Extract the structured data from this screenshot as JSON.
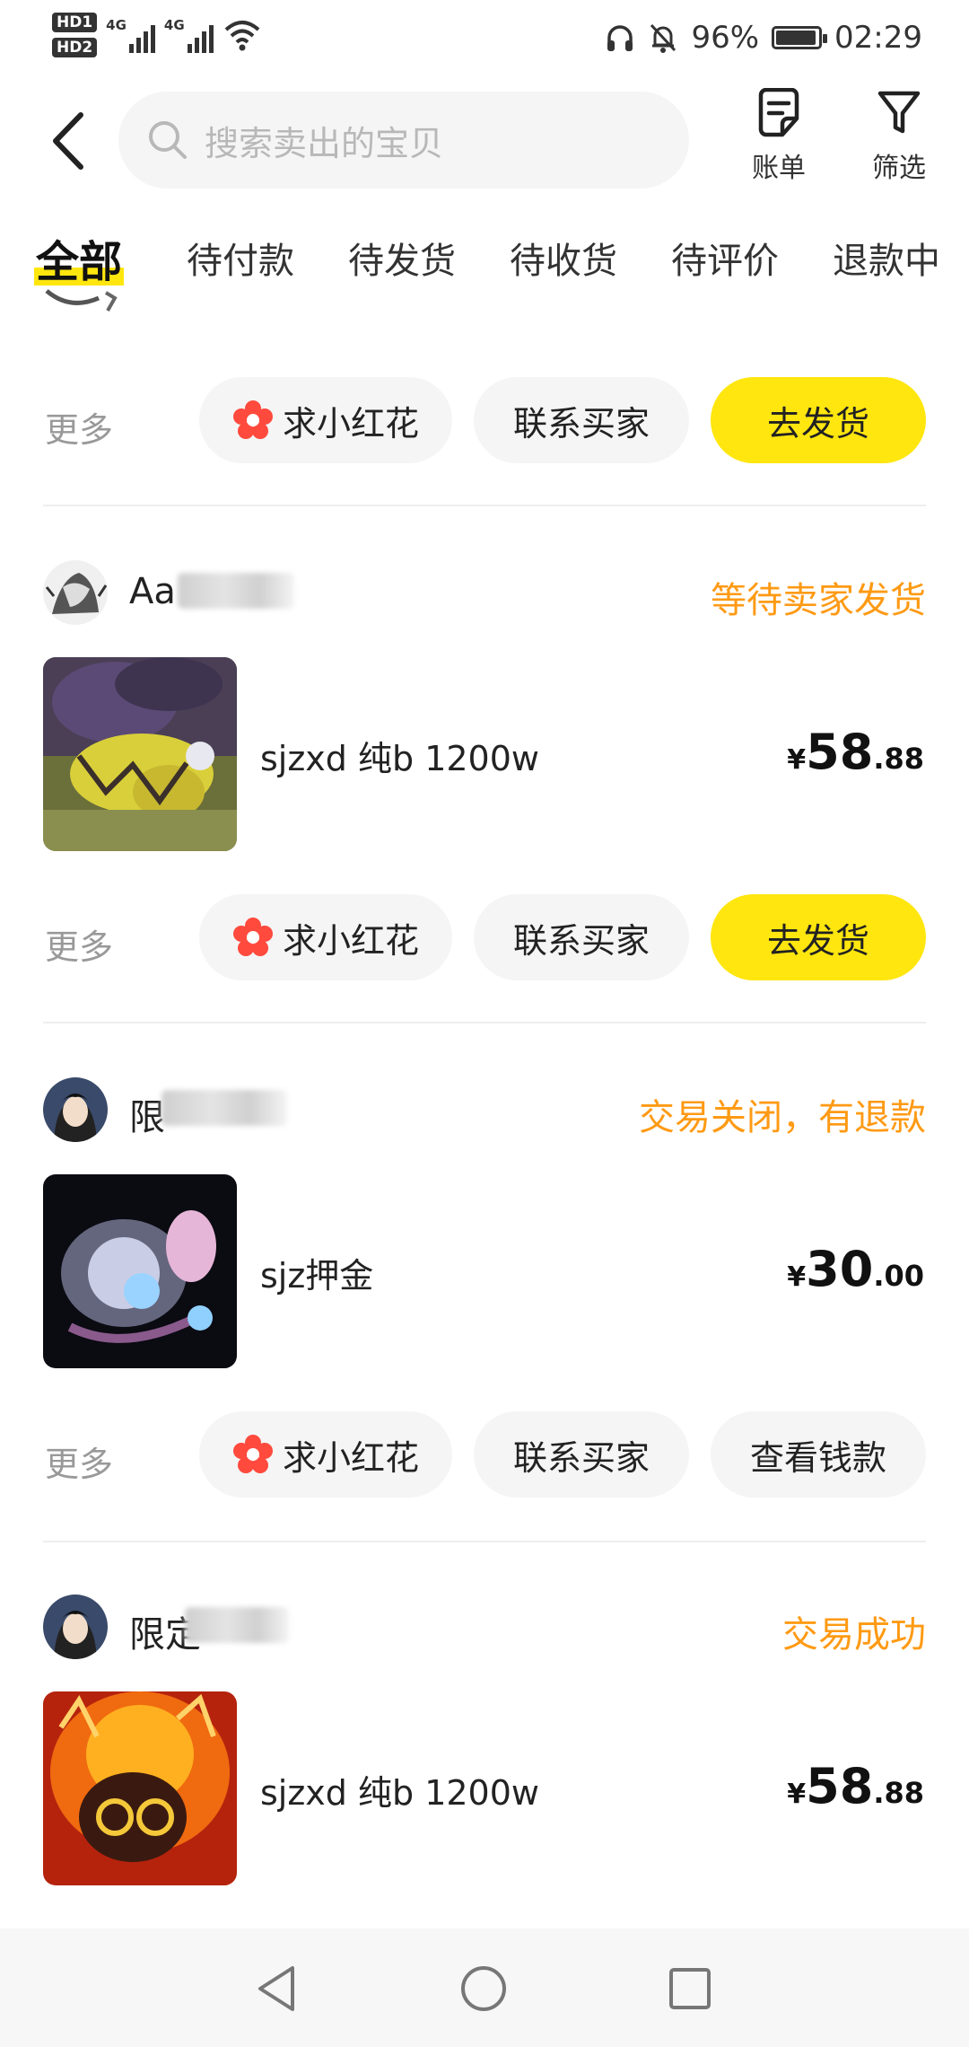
{
  "status_bar": {
    "hd1": "HD1",
    "hd2": "HD2",
    "net1": "4G",
    "net2": "4G",
    "battery": "96%",
    "time": "02:29"
  },
  "header": {
    "search_placeholder": "搜索卖出的宝贝",
    "bill_label": "账单",
    "filter_label": "筛选"
  },
  "tabs": [
    "全部",
    "待付款",
    "待发货",
    "待收货",
    "待评价",
    "退款中"
  ],
  "accent_color": "#ffe60f",
  "status_color": "#ff9a14",
  "orders": [
    {
      "more": "更多",
      "actions": [
        "求小红花",
        "联系买家",
        "去发货"
      ]
    },
    {
      "seller": "Aa",
      "status": "等待卖家发货",
      "item": "sjzxd 纯b 1200w",
      "currency": "¥",
      "price_int": "58",
      "price_dec": ".88",
      "more": "更多",
      "actions": [
        "求小红花",
        "联系买家",
        "去发货"
      ]
    },
    {
      "seller": "限",
      "status": "交易关闭，有退款",
      "item": "sjz押金",
      "currency": "¥",
      "price_int": "30",
      "price_dec": ".00",
      "more": "更多",
      "actions": [
        "求小红花",
        "联系买家",
        "查看钱款"
      ]
    },
    {
      "seller": "限定",
      "status": "交易成功",
      "item": "sjzxd 纯b 1200w",
      "currency": "¥",
      "price_int": "58",
      "price_dec": ".88"
    }
  ],
  "icons": {
    "back": "back-arrow-icon",
    "search": "search-icon",
    "bill": "bill-icon",
    "filter": "filter-icon",
    "flower": "flower-icon",
    "nav_back": "nav-back-icon",
    "nav_home": "nav-home-icon",
    "nav_recent": "nav-recent-icon"
  }
}
